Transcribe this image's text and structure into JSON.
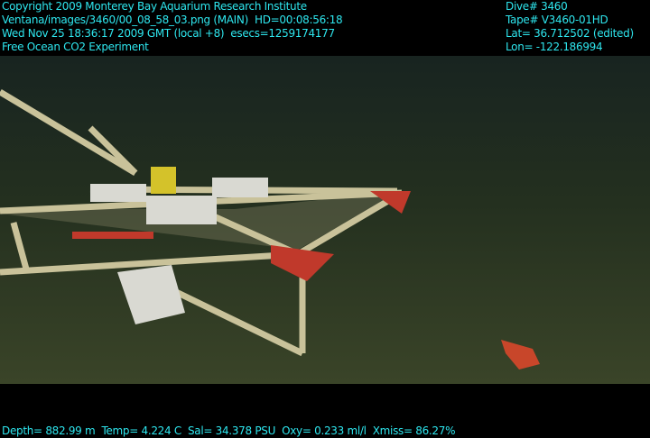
{
  "header_left": [
    "Copyright 2009 Monterey Bay Aquarium Research Institute",
    "Ventana/images/3460/00_08_58_03.png (MAIN)  HD=00:08:56:18",
    "Wed Nov 25 18:36:17 2009 GMT (local +8)  esecs=1259174177",
    "Free Ocean CO2 Experiment"
  ],
  "header_right": [
    "Dive# 3460",
    "Tape# V3460-01HD",
    "Lat= 36.712502 (edited)",
    "Lon= -122.186994"
  ],
  "footer": "Depth= 882.99 m  Temp= 4.224 C  Sal= 34.378 PSU  Oxy= 0.233 ml/l  Xmiss= 86.27%",
  "colors": {
    "overlay_text": "#2ee6ee",
    "water": "#1d2a24",
    "seafloor": "#34402a",
    "frame": "#c9c29a",
    "red": "#c0392b"
  }
}
